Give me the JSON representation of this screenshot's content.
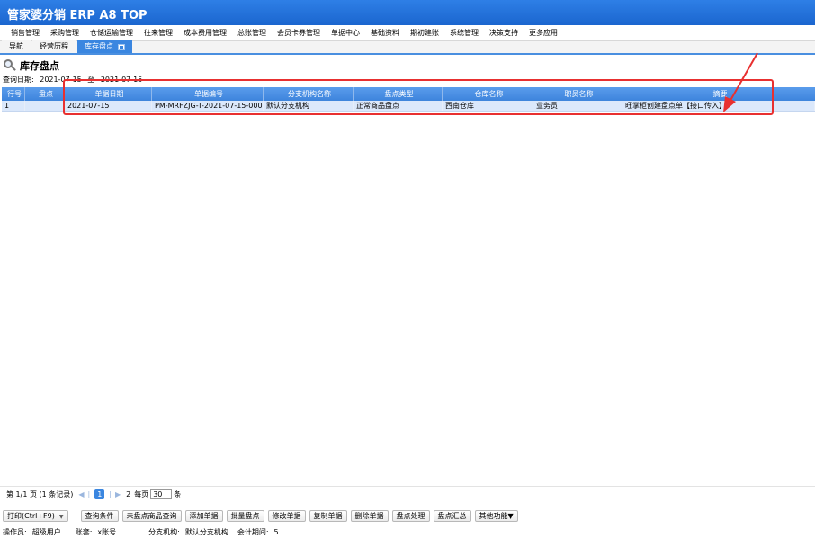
{
  "app": {
    "title": "管家婆分销 ERP A8 TOP"
  },
  "menu": [
    "销售管理",
    "采购管理",
    "仓储运输管理",
    "往来管理",
    "成本费用管理",
    "总账管理",
    "会员卡券管理",
    "单据中心",
    "基础资料",
    "期初建账",
    "系统管理",
    "决策支持",
    "更多应用"
  ],
  "tabs": [
    {
      "label": "导航"
    },
    {
      "label": "经营历程"
    },
    {
      "label": "库存盘点"
    }
  ],
  "page": {
    "title": "库存盘点",
    "query_label": "查询日期:",
    "date_from": "2021-07-15",
    "date_sep": "至",
    "date_to": "2021-07-15"
  },
  "grid": {
    "headers": [
      "行号",
      "盘点",
      "单据日期",
      "单据编号",
      "分支机构名称",
      "盘点类型",
      "仓库名称",
      "职员名称",
      "摘要"
    ],
    "rows": [
      [
        "1",
        "",
        "2021-07-15",
        "PM-MRFZJG-T-2021-07-15-0001",
        "默认分支机构",
        "正常商品盘点",
        "西南仓库",
        "业务员",
        "旺掌柜创建盘点单【接口传入】"
      ]
    ]
  },
  "pager": {
    "summary": "第 1/1 页 (1 条记录)",
    "current_page": "1",
    "next_page": "2",
    "per_page_label": "每页",
    "per_page_value": "30",
    "per_page_unit": "条"
  },
  "toolbar": {
    "print": "打印(Ctrl+F9)",
    "buttons": [
      "查询条件",
      "未盘点商品查询",
      "添加单据",
      "批量盘点",
      "修改单据",
      "复制单据",
      "删除单据",
      "盘点处理",
      "盘点汇总",
      "其他功能▼"
    ]
  },
  "status": {
    "operator_label": "操作员:",
    "operator": "超级用户",
    "account_label": "账套:",
    "account": "x账号",
    "branch_label": "分支机构:",
    "branch": "默认分支机构",
    "period_label": "会计期间:",
    "period": "5"
  },
  "colors": {
    "title_bar": "#1b66cf",
    "grid_header": "#3d84dc",
    "selected_row": "#dbe8fb",
    "annotation": "#e83030"
  },
  "icons": {
    "page_title": "magnifier-icon",
    "tab_close": "close-tab-icon",
    "print_dropdown": "chevron-down-icon"
  }
}
